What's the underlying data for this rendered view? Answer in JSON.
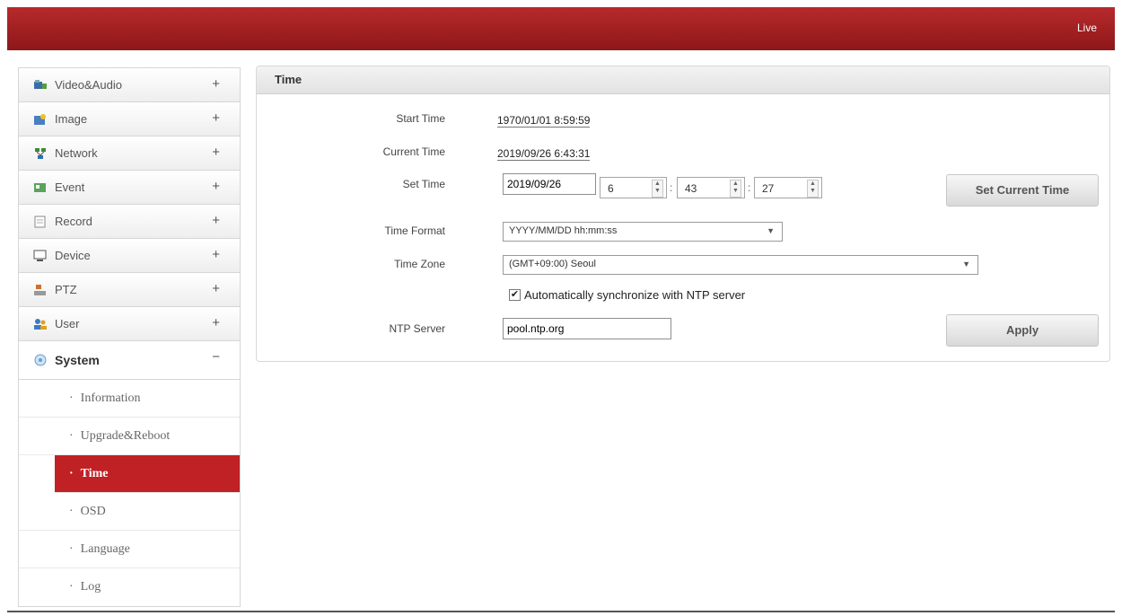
{
  "header": {
    "live_label": "Live"
  },
  "sidebar": {
    "items": [
      {
        "label": "Video&Audio",
        "sign": "+",
        "icon": "video-audio-icon"
      },
      {
        "label": "Image",
        "sign": "+",
        "icon": "image-icon"
      },
      {
        "label": "Network",
        "sign": "+",
        "icon": "network-icon"
      },
      {
        "label": "Event",
        "sign": "+",
        "icon": "event-icon"
      },
      {
        "label": "Record",
        "sign": "+",
        "icon": "record-icon"
      },
      {
        "label": "Device",
        "sign": "+",
        "icon": "device-icon"
      },
      {
        "label": "PTZ",
        "sign": "+",
        "icon": "ptz-icon"
      },
      {
        "label": "User",
        "sign": "+",
        "icon": "user-icon"
      },
      {
        "label": "System",
        "sign": "−",
        "icon": "system-icon"
      }
    ],
    "sub_items": [
      {
        "label": "Information"
      },
      {
        "label": "Upgrade&Reboot"
      },
      {
        "label": "Time"
      },
      {
        "label": "OSD"
      },
      {
        "label": "Language"
      },
      {
        "label": "Log"
      }
    ]
  },
  "panel": {
    "title": "Time",
    "start_time_label": "Start Time",
    "start_time_value": "1970/01/01 8:59:59",
    "current_time_label": "Current Time",
    "current_time_value": "2019/09/26 6:43:31",
    "set_time_label": "Set Time",
    "set_date_value": "2019/09/26",
    "hour_value": "6",
    "minute_value": "43",
    "second_value": "27",
    "set_current_time_button": "Set Current Time",
    "time_format_label": "Time Format",
    "time_format_value": "YYYY/MM/DD hh:mm:ss",
    "time_zone_label": "Time Zone",
    "time_zone_value": "(GMT+09:00) Seoul",
    "ntp_sync_label": "Automatically synchronize with NTP server",
    "ntp_sync_checked": true,
    "ntp_server_label": "NTP Server",
    "ntp_server_value": "pool.ntp.org",
    "apply_button": "Apply"
  },
  "colors": {
    "brand_red": "#b72a2c",
    "active_red": "#c02125"
  }
}
